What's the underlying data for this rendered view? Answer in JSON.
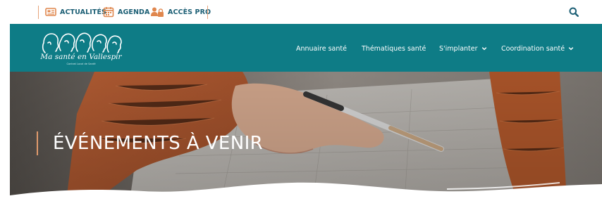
{
  "topbar": {
    "items": [
      {
        "label": "ACTUALITÉS",
        "icon": "newspaper-icon"
      },
      {
        "label": "AGENDA",
        "icon": "calendar-icon"
      },
      {
        "label": "ACCÈS PRO",
        "icon": "pro-users-lock-icon"
      }
    ],
    "search_icon": "search-icon"
  },
  "logo": {
    "script": "Ma santé en Vallespir",
    "subtitle": "Contrat Local de Santé"
  },
  "nav": {
    "items": [
      {
        "label": "Annuaire santé"
      },
      {
        "label": "Thématiques santé"
      },
      {
        "label": "S'implanter",
        "chevron": "chevron-down-icon"
      },
      {
        "label": "Coordination santé",
        "chevron": "chevron-down-icon"
      }
    ]
  },
  "hero": {
    "title": "ÉVÉNEMENTS À VENIR"
  },
  "colors": {
    "teal": "#0e7c86",
    "navy_text": "#1c5f75",
    "accent_orange": "#e09a6c",
    "white": "#ffffff"
  }
}
